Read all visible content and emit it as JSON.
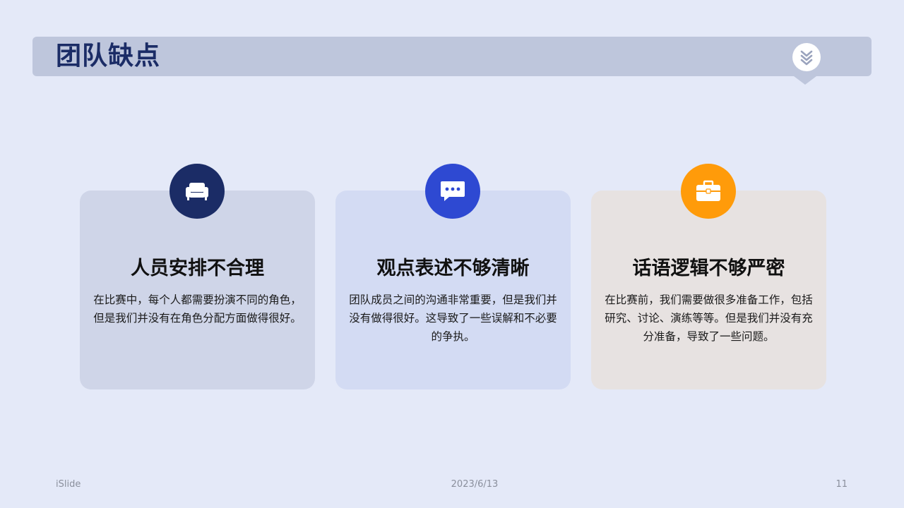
{
  "slide": {
    "title": "团队缺点",
    "badge_icon": "double-chevron-down-icon"
  },
  "cards": [
    {
      "icon": "sofa-icon",
      "color": "#1b2c66",
      "title": "人员安排不合理",
      "text": "在比赛中，每个人都需要扮演不同的角色，但是我们并没有在角色分配方面做得很好。"
    },
    {
      "icon": "chat-bubble-icon",
      "color": "#2e49d2",
      "title": "观点表述不够清晰",
      "text": "团队成员之间的沟通非常重要，但是我们并没有做得很好。这导致了一些误解和不必要的争执。"
    },
    {
      "icon": "briefcase-icon",
      "color": "#ff9b0a",
      "title": "话语逻辑不够严密",
      "text": "在比赛前，我们需要做很多准备工作，包括研究、讨论、演练等等。但是我们并没有充分准备，导致了一些问题。"
    }
  ],
  "footer": {
    "brand": "iSlide",
    "date": "2023/6/13",
    "page": "11"
  }
}
